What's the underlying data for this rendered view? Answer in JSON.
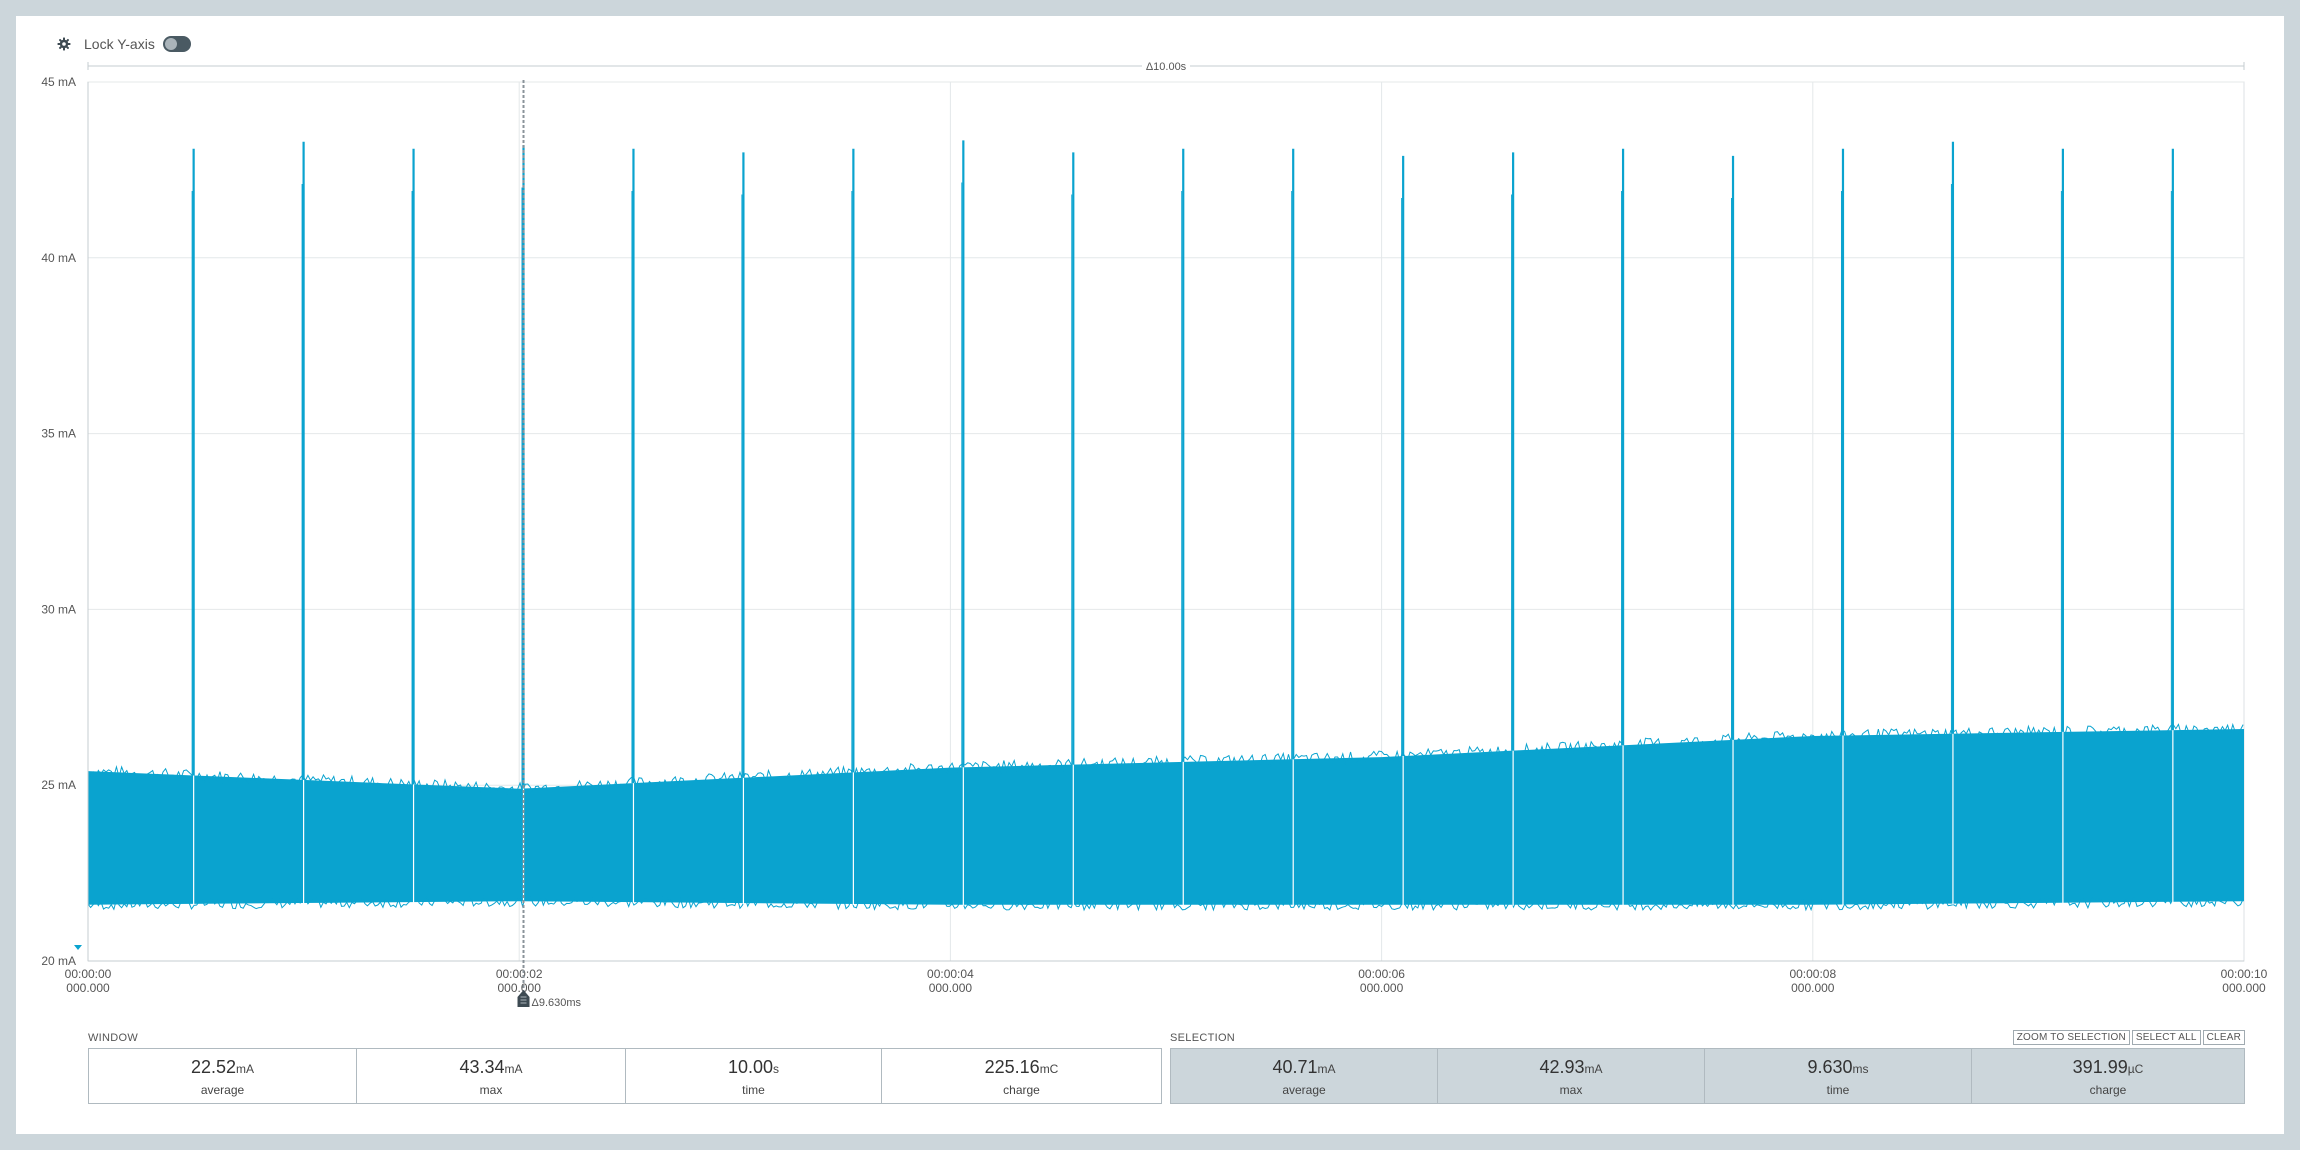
{
  "toolbar": {
    "settings_icon": "gear-icon",
    "lock_label": "Lock Y-axis",
    "lock_enabled": false
  },
  "chart_data": {
    "type": "line",
    "title": "",
    "xlabel": "",
    "ylabel": "",
    "ylim": [
      20,
      45
    ],
    "xlim": [
      0,
      10
    ],
    "x_unit": "s",
    "y_unit": "mA",
    "yticks": [
      "20 mA",
      "25 mA",
      "30 mA",
      "35 mA",
      "40 mA",
      "45 mA"
    ],
    "ytick_values": [
      20,
      25,
      30,
      35,
      40,
      45
    ],
    "xticks": [
      {
        "value": 0,
        "line1": "00:00:00",
        "line2": "000.000"
      },
      {
        "value": 2,
        "line1": "00:00:02",
        "line2": "000.000"
      },
      {
        "value": 4,
        "line1": "00:00:04",
        "line2": "000.000"
      },
      {
        "value": 6,
        "line1": "00:00:06",
        "line2": "000.000"
      },
      {
        "value": 8,
        "line1": "00:00:08",
        "line2": "000.000"
      },
      {
        "value": 10,
        "line1": "00:00:10",
        "line2": "000.000"
      }
    ],
    "window_delta_label": "Δ10.00s",
    "series": [
      {
        "color": "#0aa3cf",
        "baseline_band": [
          {
            "x": 0,
            "low": 21.6,
            "high": 25.4
          },
          {
            "x": 2,
            "low": 21.7,
            "high": 24.9
          },
          {
            "x": 4,
            "low": 21.6,
            "high": 25.5
          },
          {
            "x": 6,
            "low": 21.6,
            "high": 25.8
          },
          {
            "x": 8,
            "low": 21.6,
            "high": 26.4
          },
          {
            "x": 10,
            "low": 21.7,
            "high": 26.6
          }
        ],
        "pulses": [
          {
            "x": 0.49,
            "peak": 43.1
          },
          {
            "x": 1.0,
            "peak": 43.3
          },
          {
            "x": 1.51,
            "peak": 43.1
          },
          {
            "x": 2.02,
            "peak": 43.2
          },
          {
            "x": 2.53,
            "peak": 43.1
          },
          {
            "x": 3.04,
            "peak": 43.0
          },
          {
            "x": 3.55,
            "peak": 43.1
          },
          {
            "x": 4.06,
            "peak": 43.34
          },
          {
            "x": 4.57,
            "peak": 43.0
          },
          {
            "x": 5.08,
            "peak": 43.1
          },
          {
            "x": 5.59,
            "peak": 43.1
          },
          {
            "x": 6.1,
            "peak": 42.9
          },
          {
            "x": 6.61,
            "peak": 43.0
          },
          {
            "x": 7.12,
            "peak": 43.1
          },
          {
            "x": 7.63,
            "peak": 42.9
          },
          {
            "x": 8.14,
            "peak": 43.1
          },
          {
            "x": 8.65,
            "peak": 43.3
          },
          {
            "x": 9.16,
            "peak": 43.1
          },
          {
            "x": 9.67,
            "peak": 43.1
          }
        ]
      }
    ],
    "selection": {
      "x": 2.02,
      "delta_label": "Δ9.630ms"
    }
  },
  "window": {
    "title": "WINDOW",
    "stats": [
      {
        "value": "22.52",
        "unit": "mA",
        "label": "average"
      },
      {
        "value": "43.34",
        "unit": "mA",
        "label": "max"
      },
      {
        "value": "10.00",
        "unit": "s",
        "label": "time"
      },
      {
        "value": "225.16",
        "unit": "mC",
        "label": "charge"
      }
    ]
  },
  "selection": {
    "title": "SELECTION",
    "buttons": [
      "ZOOM TO SELECTION",
      "SELECT ALL",
      "CLEAR"
    ],
    "stats": [
      {
        "value": "40.71",
        "unit": "mA",
        "label": "average"
      },
      {
        "value": "42.93",
        "unit": "mA",
        "label": "max"
      },
      {
        "value": "9.630",
        "unit": "ms",
        "label": "time"
      },
      {
        "value": "391.99",
        "unit": "µC",
        "label": "charge"
      }
    ]
  }
}
